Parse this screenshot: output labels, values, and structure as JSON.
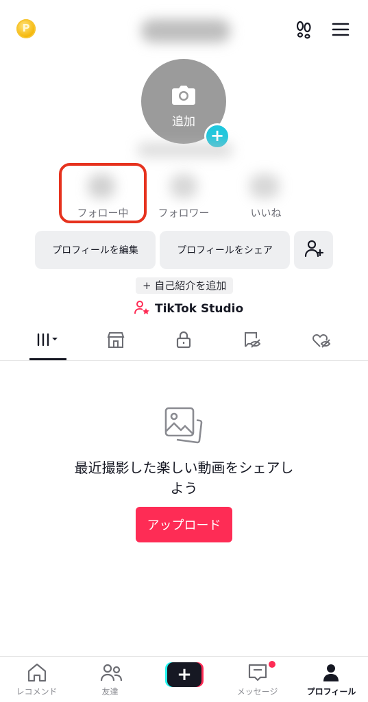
{
  "header": {
    "coin_symbol": "P",
    "menu_icon": "hamburger-icon",
    "footprints_icon": "footprints-icon"
  },
  "avatar": {
    "add_label": "追加",
    "plus": "+"
  },
  "stats": {
    "following_label": "フォロー中",
    "followers_label": "フォロワー",
    "likes_label": "いいね"
  },
  "actions": {
    "edit_profile": "プロフィールを編集",
    "share_profile": "プロフィールをシェア",
    "add_bio": "+ 自己紹介を追加",
    "studio": "TikTok Studio"
  },
  "tabs": [
    "videos-grid",
    "shop",
    "private",
    "reposts",
    "liked"
  ],
  "empty_state": {
    "message": "最近撮影した楽しい動画をシェアしよう",
    "upload_button": "アップロード"
  },
  "bottom_nav": {
    "home": "レコメンド",
    "friends": "友達",
    "create": "+",
    "inbox": "メッセージ",
    "profile": "プロフィール"
  },
  "colors": {
    "accent": "#fe2c55",
    "cyan": "#20c7dd",
    "highlight": "#e6321e"
  }
}
